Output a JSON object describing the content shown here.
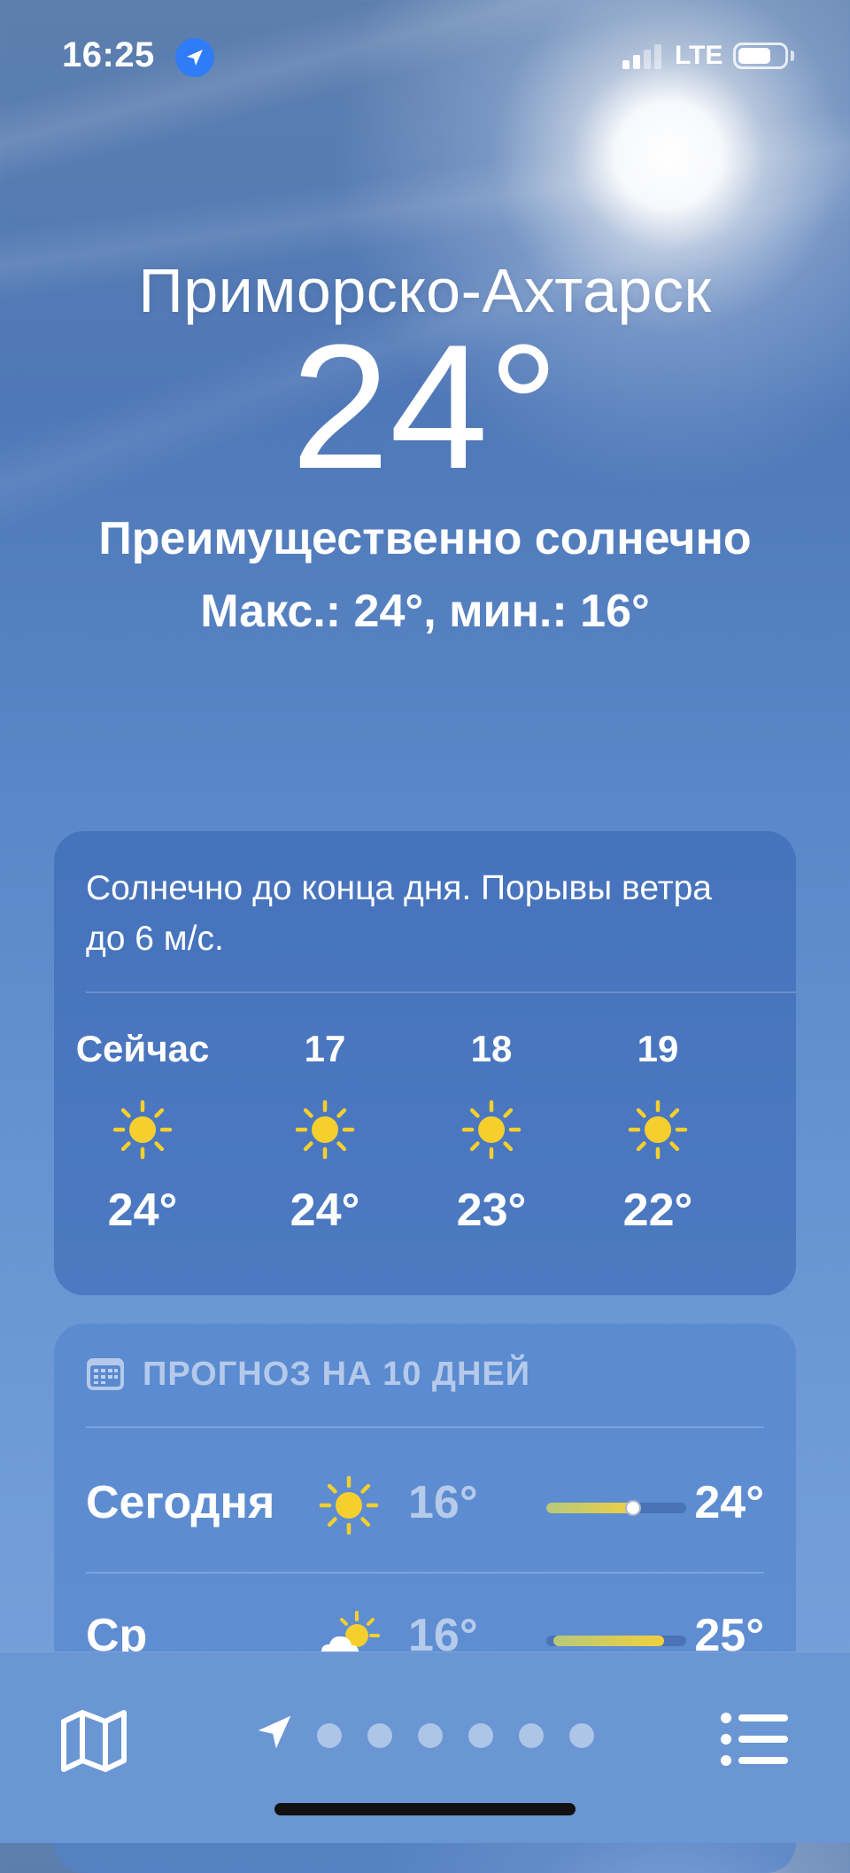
{
  "status_bar": {
    "time": "16:25",
    "network": "LTE",
    "location_icon": "location-arrow-icon",
    "battery_level_fraction": 0.72
  },
  "header": {
    "city": "Приморско-Ахтарск",
    "temperature": "24°",
    "condition": "Преимущественно солнечно",
    "high_low": "Макс.: 24°, мин.: 16°"
  },
  "hourly": {
    "summary": "Солнечно до конца дня. Порывы ветра до 6 м/с.",
    "items": [
      {
        "label": "Сейчас",
        "icon": "sun-icon",
        "temp": "24°"
      },
      {
        "label": "17",
        "icon": "sun-icon",
        "temp": "24°"
      },
      {
        "label": "18",
        "icon": "sun-icon",
        "temp": "23°"
      },
      {
        "label": "19",
        "icon": "sun-icon",
        "temp": "22°"
      }
    ]
  },
  "daily": {
    "title": "ПРОГНОЗ НА 10 ДНЕЙ",
    "title_icon": "calendar-icon",
    "days": [
      {
        "name": "Сегодня",
        "icon": "sun-icon",
        "low": "16°",
        "high": "24°",
        "range_start": 0.0,
        "range_end": 0.68,
        "current": 0.62
      },
      {
        "name": "Ср",
        "icon": "partly-cloudy-icon",
        "low": "16°",
        "high": "25°",
        "range_start": 0.05,
        "range_end": 0.84
      }
    ]
  },
  "bottom_bar": {
    "map_icon": "map-icon",
    "location_icon": "location-arrow-icon",
    "page_count": 6,
    "list_icon": "list-icon"
  },
  "colors": {
    "sun": "#f5cf2e",
    "location_badge": "#2f7cf6"
  }
}
